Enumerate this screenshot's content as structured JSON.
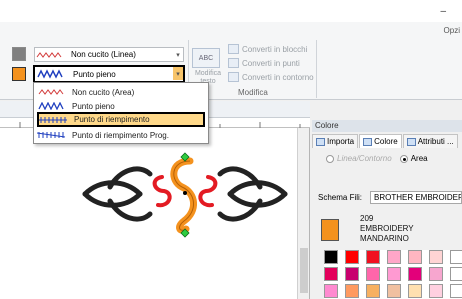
{
  "window": {
    "minimize_glyph": "–",
    "options_label": "Opzi"
  },
  "ribbon": {
    "stitch_line": {
      "label": "Non cucito (Linea)",
      "swatch_color": "#808080"
    },
    "stitch_area": {
      "label": "Punto pieno",
      "swatch_color": "#f4921e"
    },
    "modifica_button": "Modifica testo",
    "modifica_group_label": "Modifica",
    "convert_blocks": "Converti in blocchi",
    "convert_points": "Converti in punti",
    "convert_outline": "Converti in contorno"
  },
  "dropdown": {
    "items": [
      {
        "label": "Non cucito (Area)"
      },
      {
        "label": "Punto pieno"
      },
      {
        "label": "Punto di riempimento"
      },
      {
        "label": "Punto di riempimento Prog."
      }
    ],
    "selected_index": 2
  },
  "panel": {
    "title": "Colore",
    "tabs": [
      "Importa",
      "Colore",
      "Attributi ..."
    ],
    "radio_line": "Linea/Contorno",
    "radio_area": "Area",
    "schema_label": "Schema Fili:",
    "schema_value": "BROTHER EMBROIDERY",
    "current_color": {
      "number": "209",
      "brand": "EMBROIDERY",
      "name": "MANDARINO",
      "hex": "#f4921e"
    },
    "palette_rows": [
      [
        "#000000",
        "#ff0000",
        "#f01020",
        "#ffa6c8",
        "#ffb6c1",
        "#ffd4d4",
        "#fff"
      ],
      [
        "#e3005b",
        "#c8006e",
        "#ff66aa",
        "#ff9ad2",
        "#e3007a",
        "#f7a6cf",
        "#fff"
      ],
      [
        "#ff8ad0",
        "#ff9a60",
        "#f7b060",
        "#f0c0a0",
        "#ffe0b0",
        "#ffd0e0",
        "#fff"
      ]
    ]
  }
}
